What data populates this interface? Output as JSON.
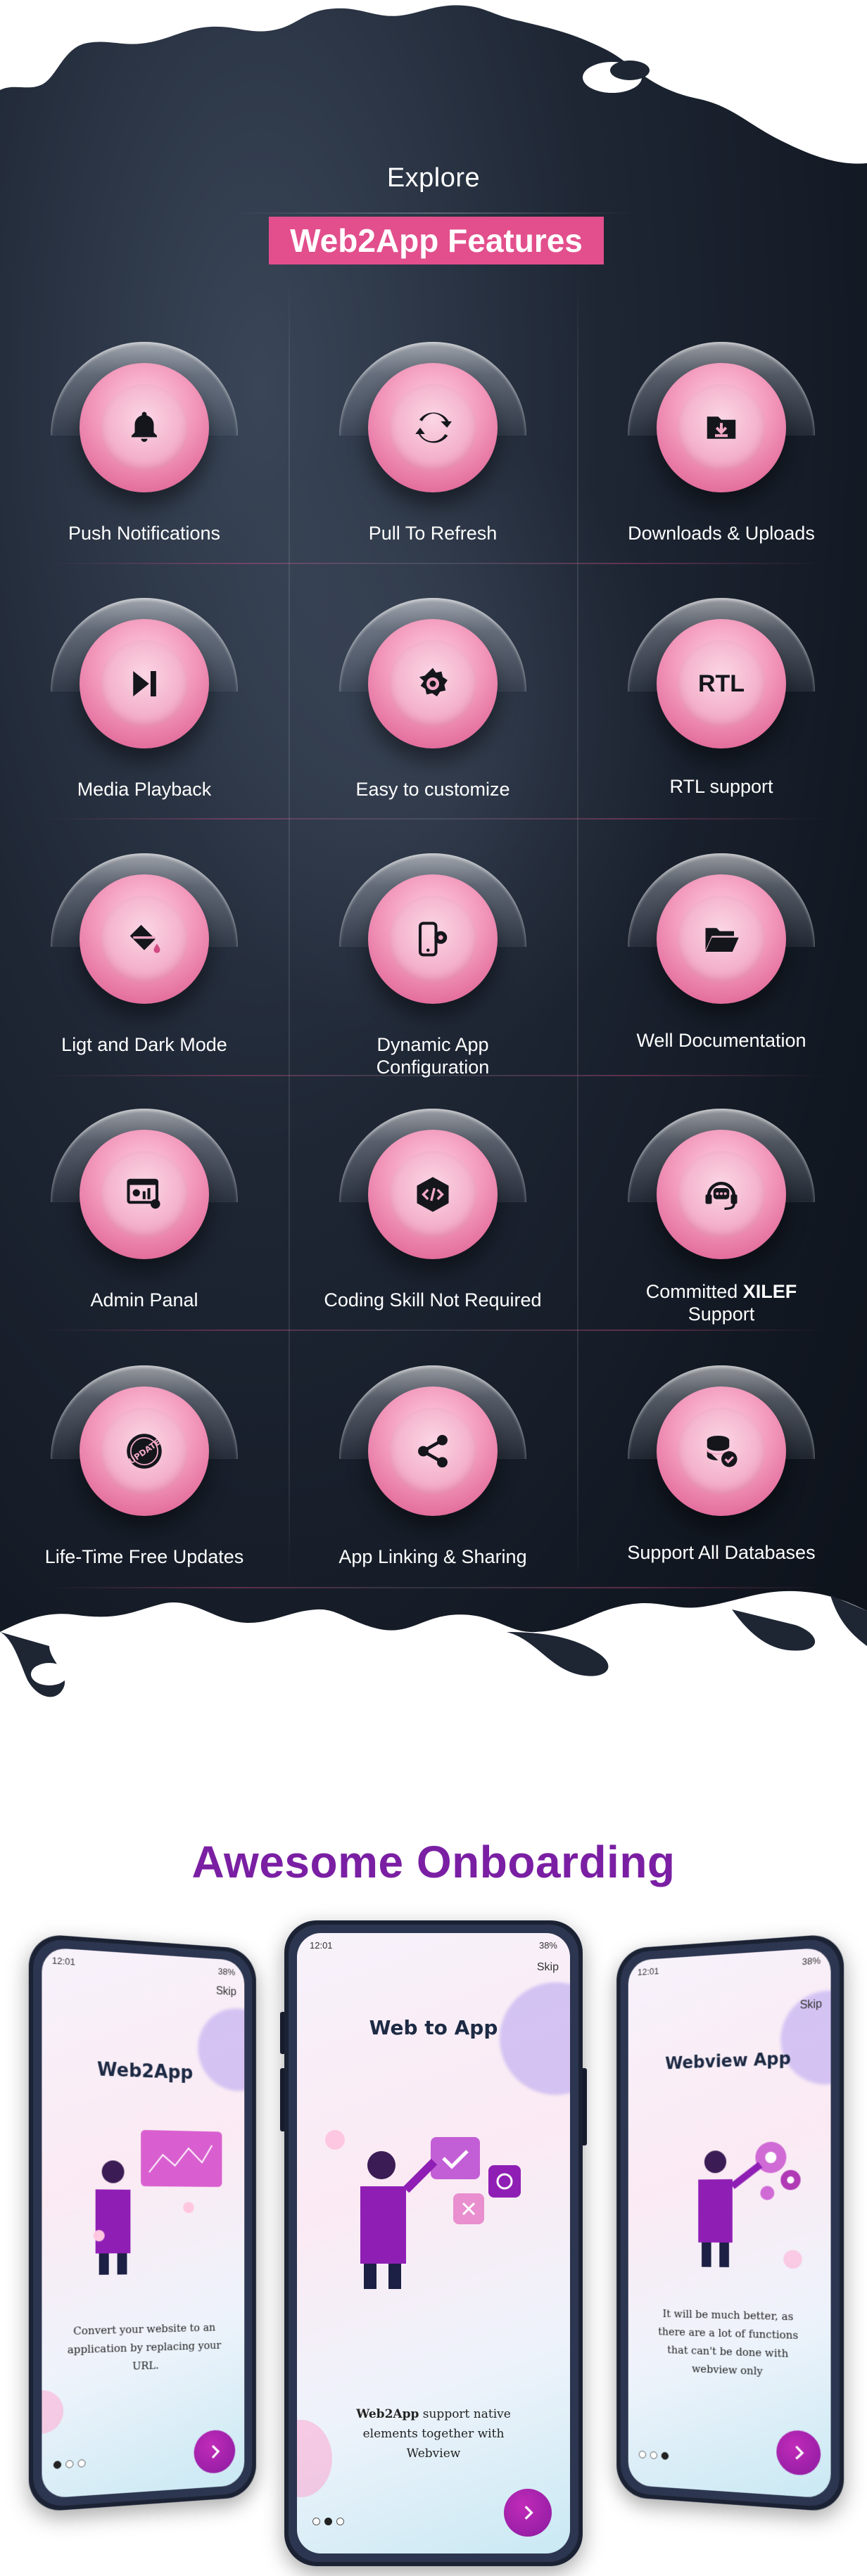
{
  "header": {
    "explore": "Explore",
    "title": "Web2App Features"
  },
  "colors": {
    "accent": "#e24f8c",
    "dark_bg": "#121822",
    "onboarding_title": "#7a1fa3",
    "button": "#8a1aa0"
  },
  "features": [
    {
      "label": "Push Notifications",
      "icon": "bell-icon"
    },
    {
      "label": "Pull To Refresh",
      "icon": "refresh-icon"
    },
    {
      "label": "Downloads & Uploads",
      "icon": "download-folder-icon"
    },
    {
      "label": "Media Playback",
      "icon": "skip-next-icon"
    },
    {
      "label": "Easy to customize",
      "icon": "gear-customize-icon"
    },
    {
      "label": "RTL support",
      "icon": "rtl-icon",
      "icon_text": "RTL"
    },
    {
      "label": "Ligt and Dark Mode",
      "icon": "paint-bucket-icon"
    },
    {
      "label_line1": "Dynamic App",
      "label_line2": "Configuration",
      "icon": "phone-settings-icon"
    },
    {
      "label": "Well Documentation",
      "icon": "folder-open-icon"
    },
    {
      "label": "Admin Panal",
      "icon": "dashboard-icon"
    },
    {
      "label": "Coding Skill Not Required",
      "icon": "code-icon"
    },
    {
      "label_prefix": "Committed ",
      "label_bold": "XILEF",
      "label_line2": "Support",
      "icon": "headset-support-icon"
    },
    {
      "label": "Life-Time Free Updates",
      "icon": "update-badge-icon"
    },
    {
      "label": "App Linking & Sharing",
      "icon": "share-icon"
    },
    {
      "label": "Support All Databases",
      "icon": "database-check-icon"
    }
  ],
  "onboarding": {
    "title": "Awesome Onboarding",
    "screens": [
      {
        "status_time": "12:01",
        "status_battery": "38%",
        "skip": "Skip",
        "title": "Web2App",
        "desc_lines": [
          "Convert your website to an",
          "application by replacing your",
          "URL."
        ]
      },
      {
        "status_time": "12:01",
        "status_battery": "38%",
        "skip": "Skip",
        "title": "Web to App",
        "desc_bold": "Web2App",
        "desc_lines": [
          " support native",
          "elements together with",
          "Webview"
        ]
      },
      {
        "status_time": "12:01",
        "status_battery": "38%",
        "skip": "Skip",
        "title": "Webview App",
        "desc_lines": [
          "It will be much better, as",
          "there are a lot of functions",
          "that can't be done with",
          "webview only"
        ]
      }
    ]
  }
}
